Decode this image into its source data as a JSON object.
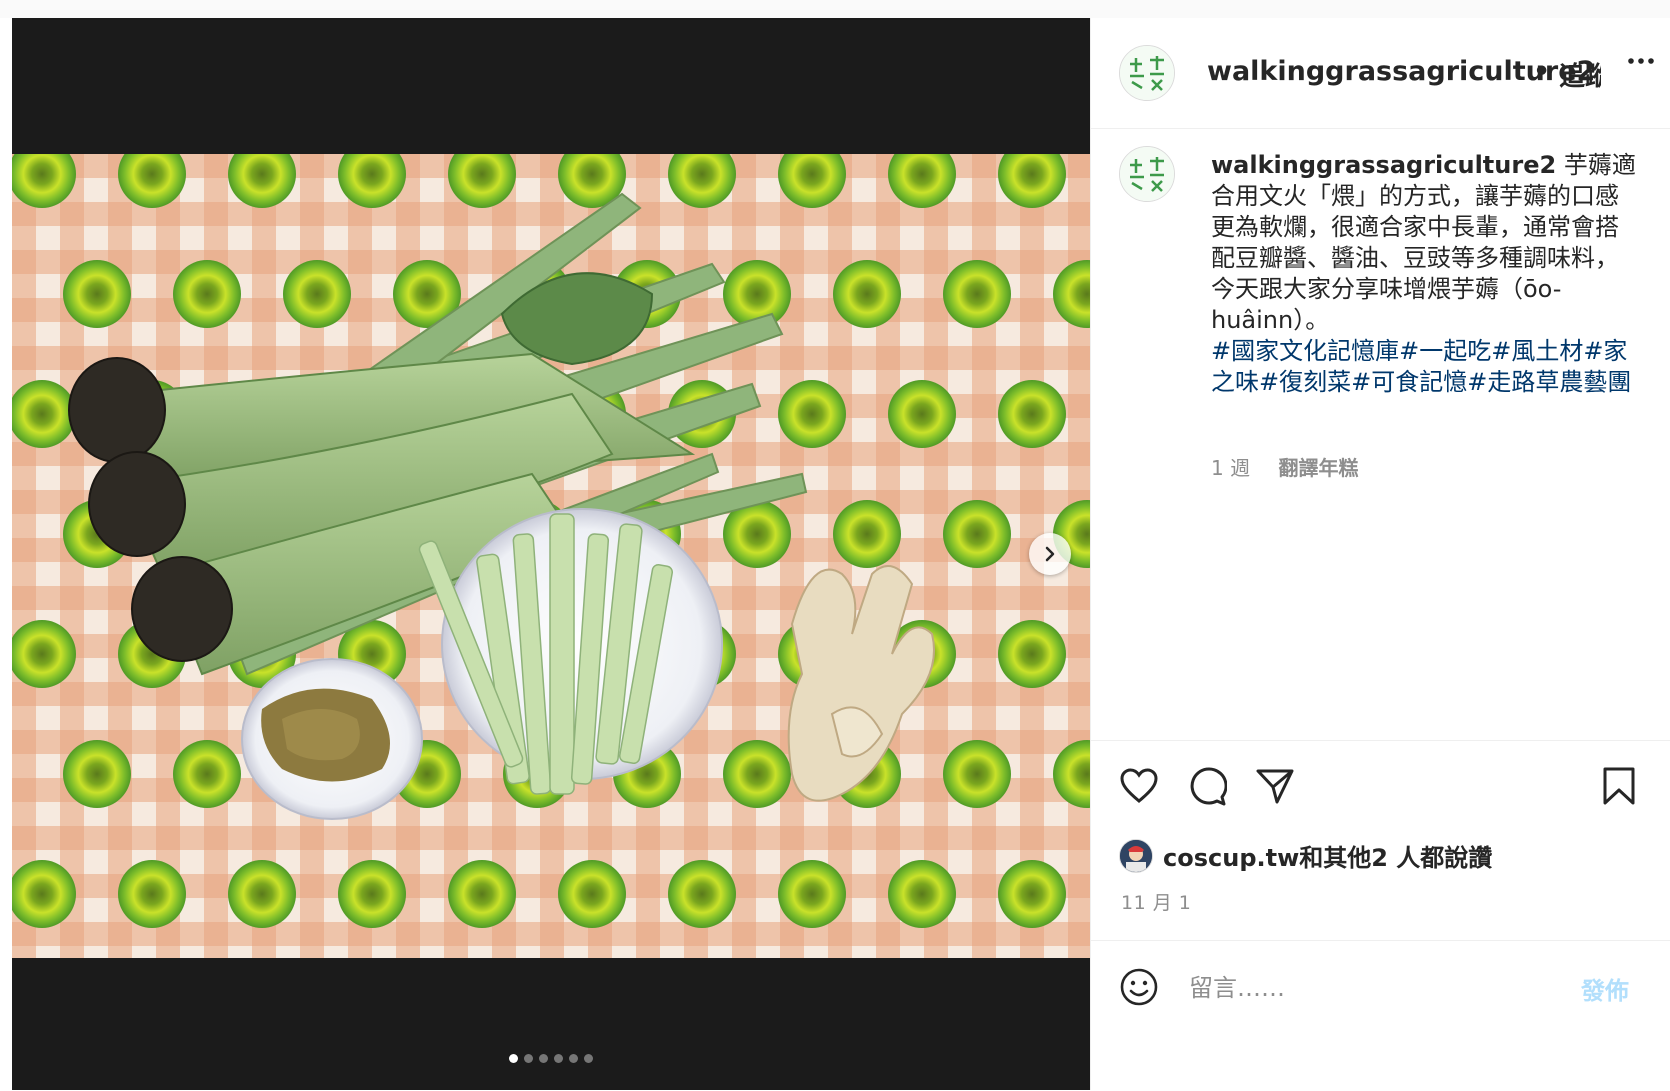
{
  "media": {
    "carousel_count": 6,
    "active_index": 0
  },
  "header": {
    "username": "walkinggrassagriculture2",
    "separator": "•",
    "follow_label": "追蹤",
    "more_label": "···"
  },
  "caption": {
    "username": "walkinggrassagriculture2",
    "text": "芋薅適合用文火「煨」的方式，讓芋薅的口感更為軟爛，很適合家中長輩，通常會搭配豆瓣醬、醬油、豆豉等多種調味料，今天跟大家分享味增煨芋薅（ōo-huâinn）。",
    "hashtags": "#國家文化記憶庫#一起吃#風土材#家之味#復刻菜#可食記憶#走路草農藝團",
    "time_ago": "1 週",
    "translate_label": "翻譯年糕"
  },
  "likes": {
    "text": "coscup.tw和其他2 人都說讚"
  },
  "date": "11 月 1",
  "comment": {
    "placeholder": "留言……",
    "post_label": "發佈"
  },
  "icons": {
    "like": "heart-icon",
    "comment": "comment-icon",
    "share": "send-icon",
    "save": "bookmark-icon",
    "emoji": "emoji-icon",
    "next": "chevron-right-icon",
    "more": "more-icon"
  },
  "colors": {
    "hashtag": "#00376b",
    "post_button_disabled": "#b2dffc",
    "muted_text": "#8e8e8e"
  }
}
